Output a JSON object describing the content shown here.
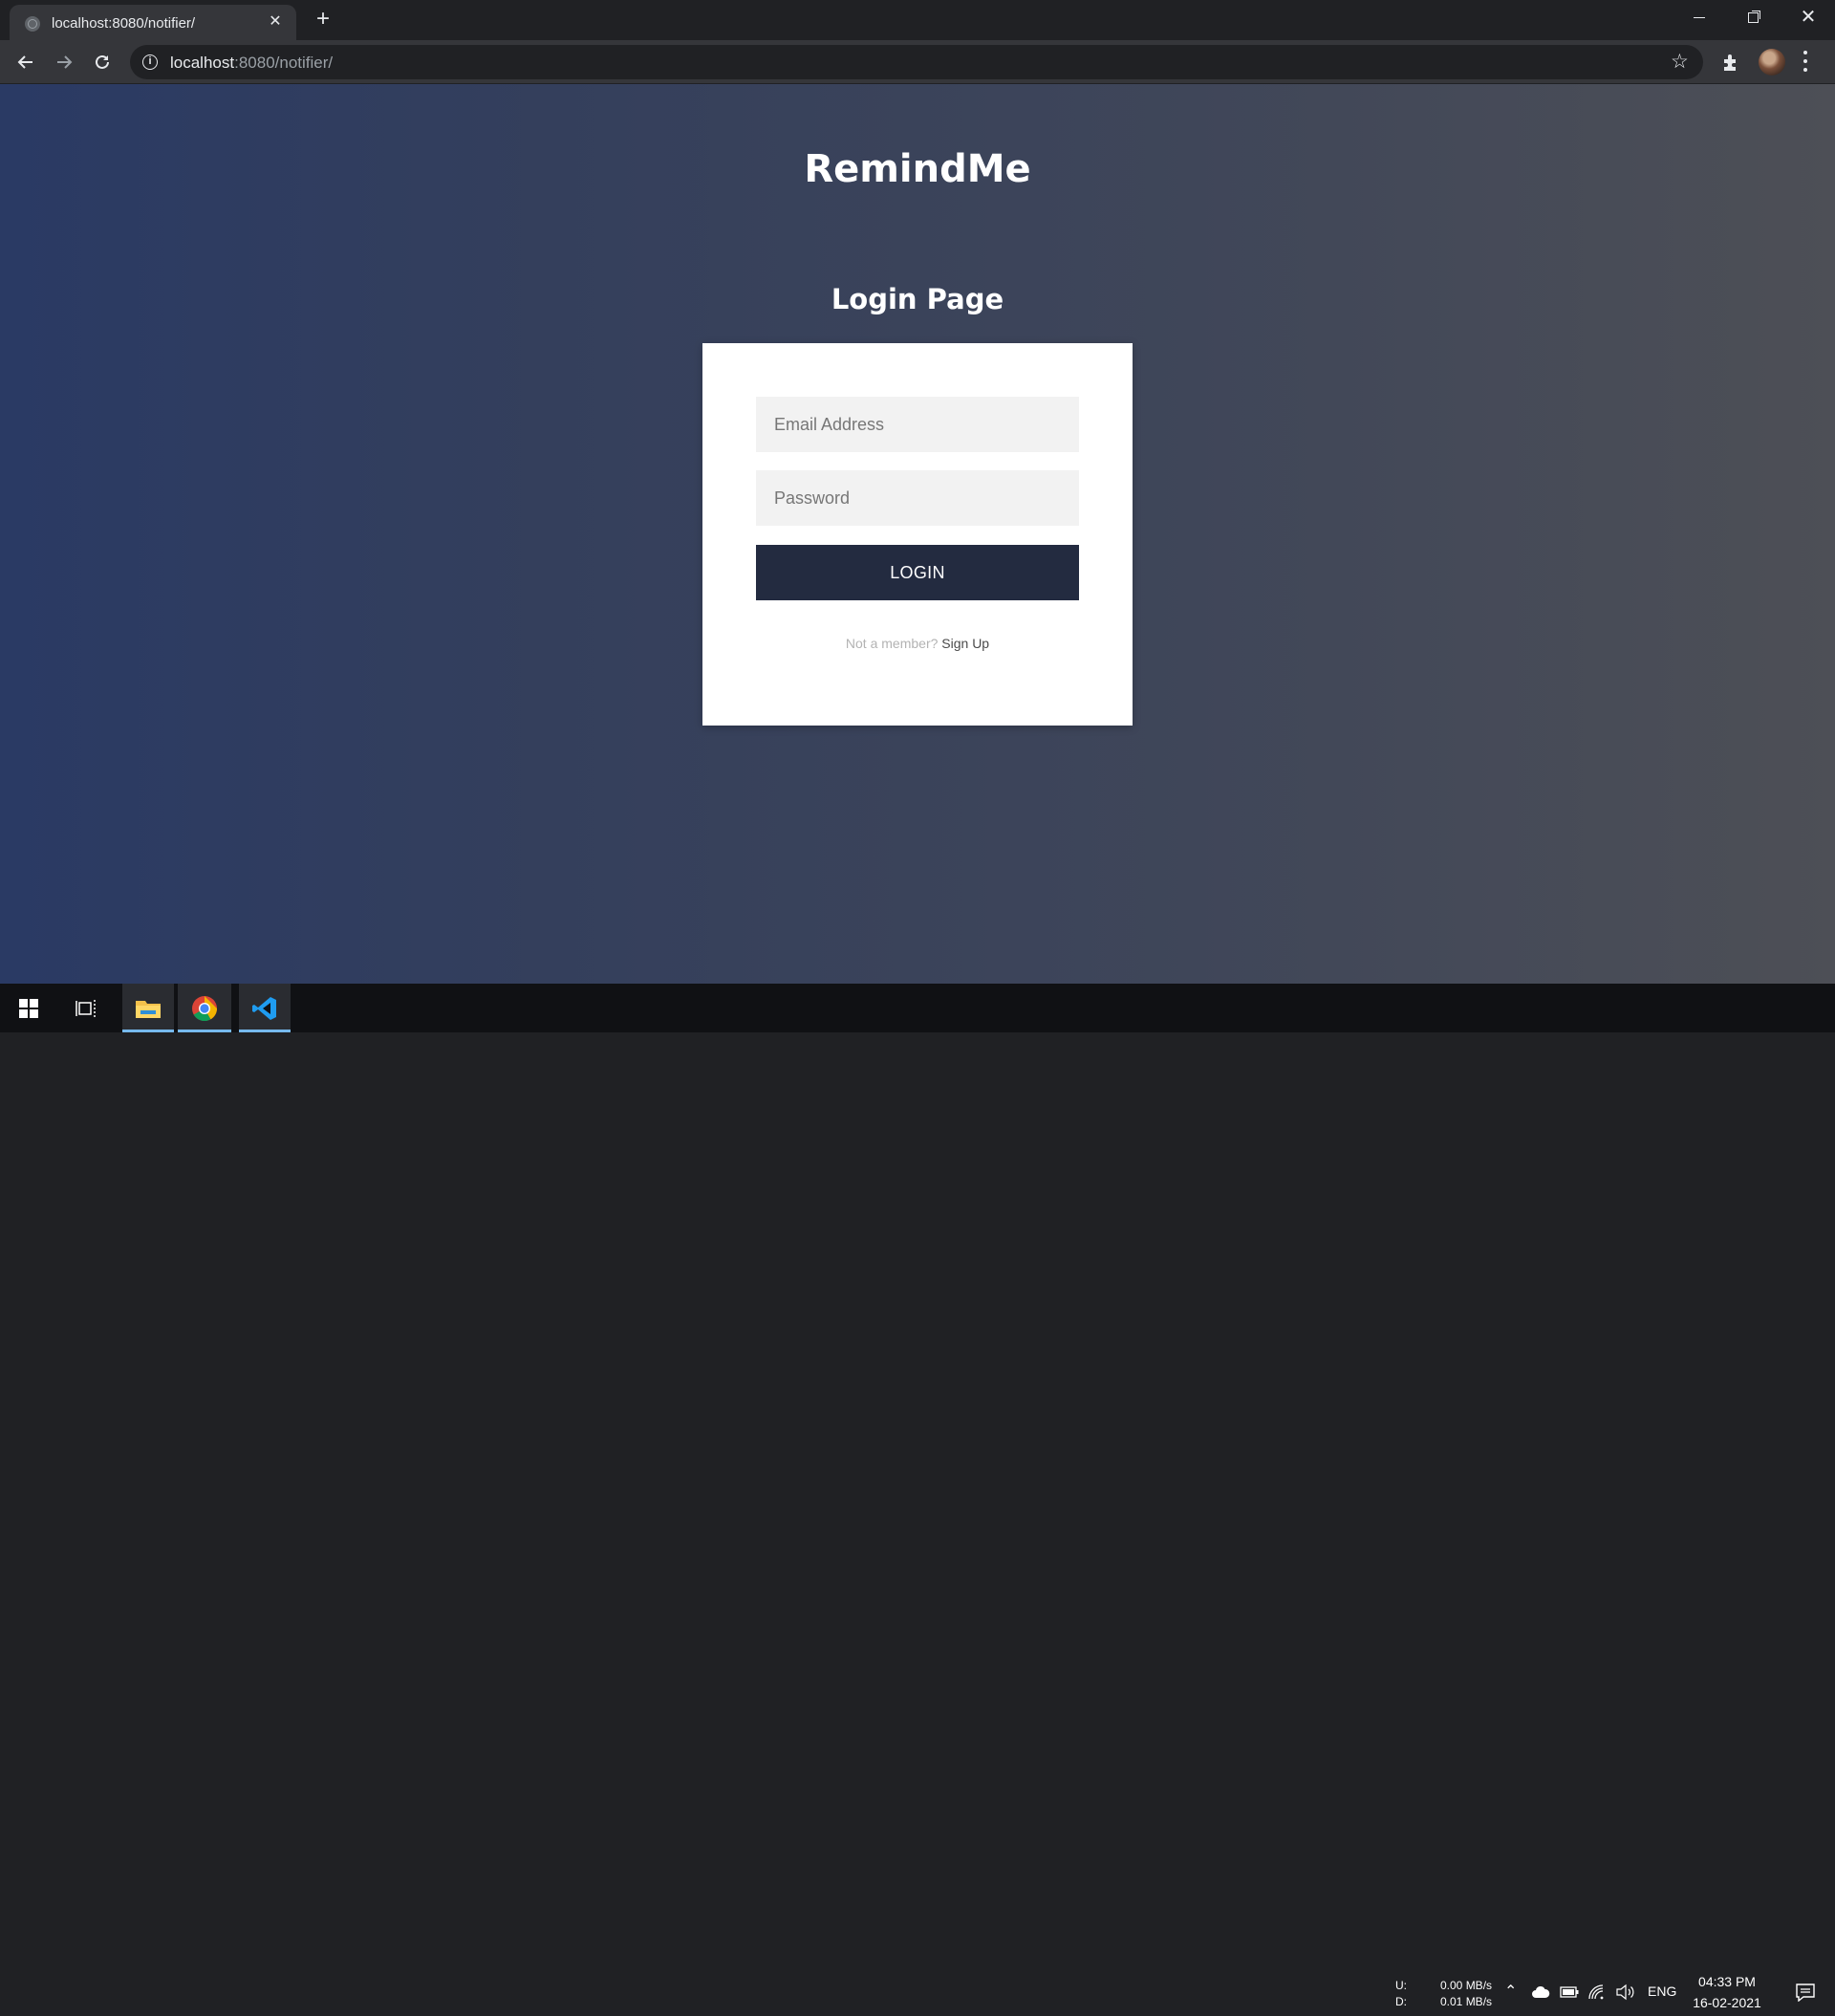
{
  "browser": {
    "tab_title": "localhost:8080/notifier/",
    "url_host": "localhost",
    "url_rest": ":8080/notifier/"
  },
  "page": {
    "app_title": "RemindMe",
    "login_heading": "Login Page",
    "email_placeholder": "Email Address",
    "password_placeholder": "Password",
    "login_button_label": "LOGIN",
    "signup_prompt": "Not a member? ",
    "signup_link_label": "Sign Up"
  },
  "taskbar": {
    "upload_label": "U:",
    "download_label": "D:",
    "upload_speed": "0.00 MB/s",
    "download_speed": "0.01 MB/s",
    "language": "ENG",
    "time": "04:33 PM",
    "date": "16-02-2021"
  },
  "icons": {
    "tab": [
      "globe-icon",
      "close-icon",
      "plus-icon"
    ],
    "window": [
      "minimize-icon",
      "restore-icon",
      "close-icon"
    ],
    "toolbar": [
      "back-arrow-icon",
      "forward-arrow-icon",
      "reload-icon",
      "info-icon",
      "star-icon",
      "puzzle-icon",
      "avatar",
      "kebab-menu-icon"
    ],
    "taskbar": [
      "windows-logo-icon",
      "task-view-icon",
      "file-explorer-icon",
      "chrome-icon",
      "vscode-icon",
      "chevron-up-icon",
      "cloud-icon",
      "battery-icon",
      "wifi-icon",
      "speaker-icon",
      "notification-icon"
    ]
  },
  "colors": {
    "login_button": "#232b40",
    "field_background": "#f2f2f2",
    "page_gradient_start": "#2a3a64",
    "page_gradient_end": "#4d4f56",
    "taskbar_active_underline": "#76b9ed"
  }
}
